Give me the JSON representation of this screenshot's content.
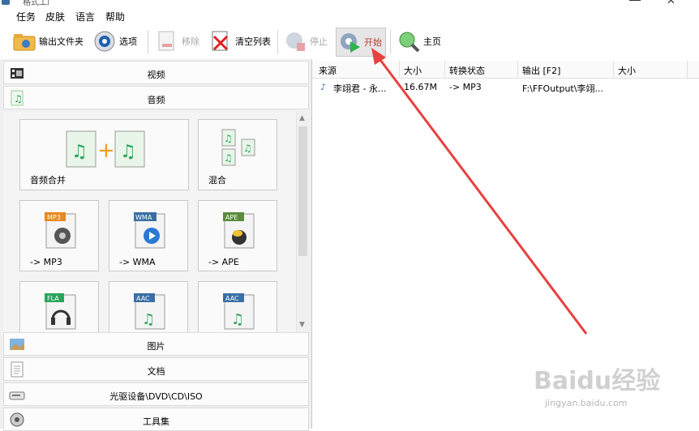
{
  "window": {
    "title": "格式工厂",
    "close_glyph": "✕"
  },
  "menu": [
    "任务",
    "皮肤",
    "语言",
    "帮助"
  ],
  "toolbar": {
    "output_folder": "输出文件夹",
    "options": "选项",
    "remove": "移除",
    "clear_list": "清空列表",
    "stop": "停止",
    "start": "开始",
    "home": "主页"
  },
  "categories": {
    "video": "视频",
    "audio": "音频",
    "image": "图片",
    "document": "文档",
    "optical": "光驱设备\\DVD\\CD\\ISO",
    "tools": "工具集"
  },
  "tiles": [
    {
      "label": "音频合并",
      "icon": "audio-merge-icon"
    },
    {
      "label": "混合",
      "icon": "audio-mix-icon"
    },
    {
      "label": "-> MP3",
      "icon": "mp3-icon",
      "badge": "MP3"
    },
    {
      "label": "-> WMA",
      "icon": "wma-icon",
      "badge": "WMA"
    },
    {
      "label": "-> APE",
      "icon": "ape-icon",
      "badge": "APE"
    },
    {
      "label": "",
      "icon": "flac-icon",
      "badge": "FLA"
    },
    {
      "label": "",
      "icon": "aac-icon",
      "badge": "AAC"
    },
    {
      "label": "",
      "icon": "aac-icon",
      "badge": "AAC"
    }
  ],
  "list": {
    "columns": [
      "来源",
      "大小",
      "转换状态",
      "输出 [F2]",
      "大小"
    ],
    "rows": [
      {
        "source": "李翊君 - 永...",
        "size": "16.67M",
        "status": "-> MP3",
        "output": "F:\\FFOutput\\李翊...",
        "out_size": ""
      }
    ]
  },
  "watermark": {
    "brand": "Baidu经验",
    "url": "jingyan.baidu.com"
  },
  "colors": {
    "accent_arrow": "#e8413e",
    "start_label": "#c0392b"
  }
}
